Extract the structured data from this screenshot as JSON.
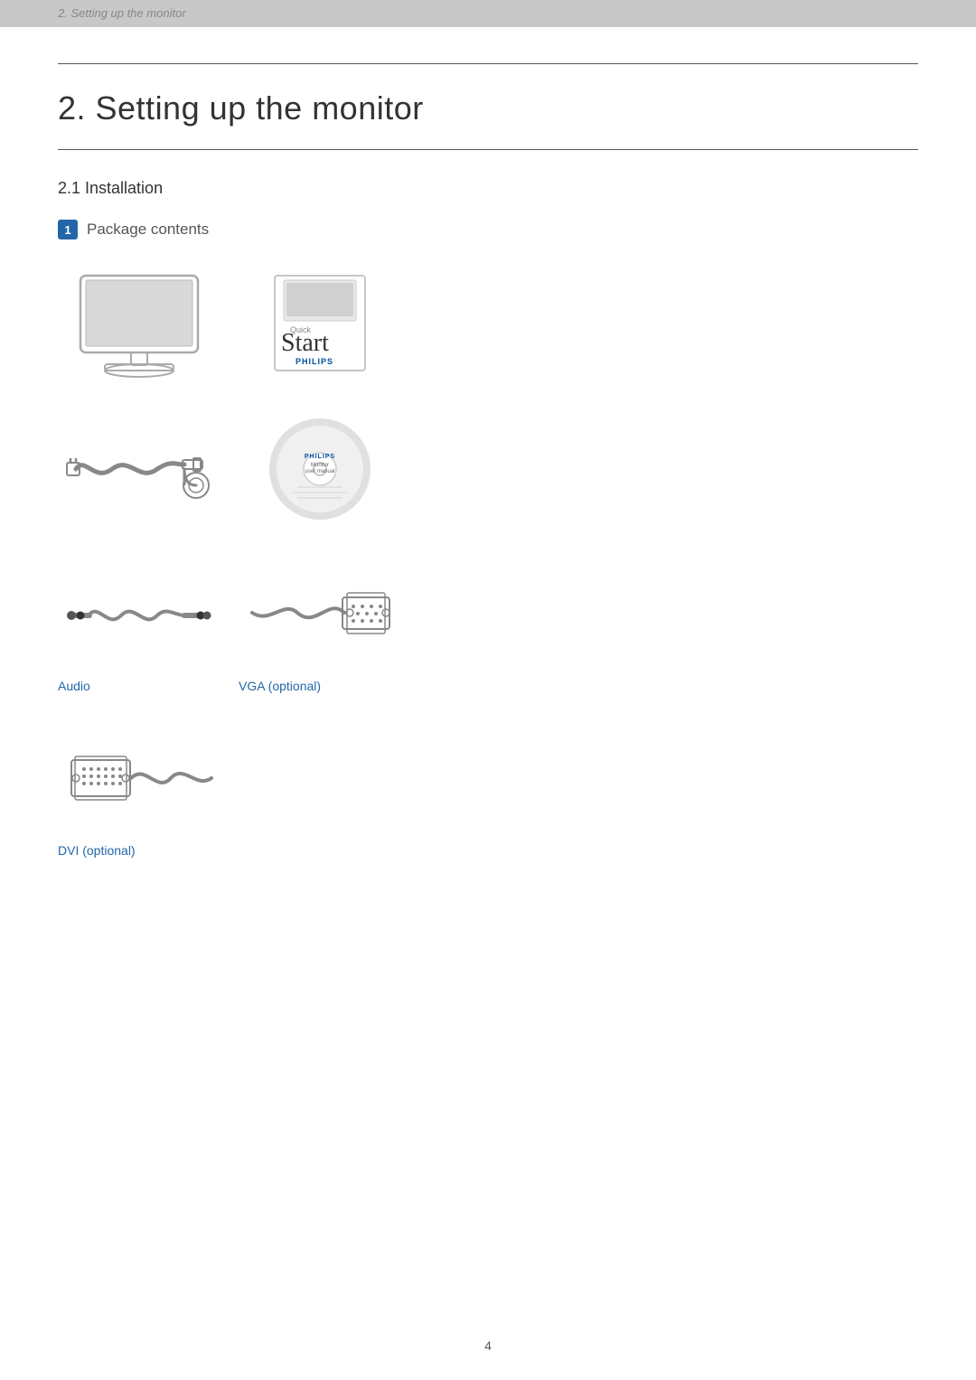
{
  "header": {
    "breadcrumb": "2. Setting up the monitor"
  },
  "page": {
    "main_title": "2.  Setting up the monitor",
    "section_subtitle": "2.1  Installation",
    "package_badge": "1",
    "package_heading": "Package contents",
    "page_number": "4"
  },
  "items": [
    {
      "id": "monitor",
      "label": "",
      "type": "monitor"
    },
    {
      "id": "quick-start",
      "label": "",
      "type": "quickstart"
    },
    {
      "id": "power-cable",
      "label": "",
      "type": "power"
    },
    {
      "id": "cd",
      "label": "",
      "type": "cd"
    },
    {
      "id": "audio-cable",
      "label": "Audio",
      "type": "audio"
    },
    {
      "id": "vga-cable",
      "label": "VGA (optional)",
      "type": "vga"
    },
    {
      "id": "dvi-cable",
      "label": "DVI (optional)",
      "type": "dvi"
    }
  ]
}
